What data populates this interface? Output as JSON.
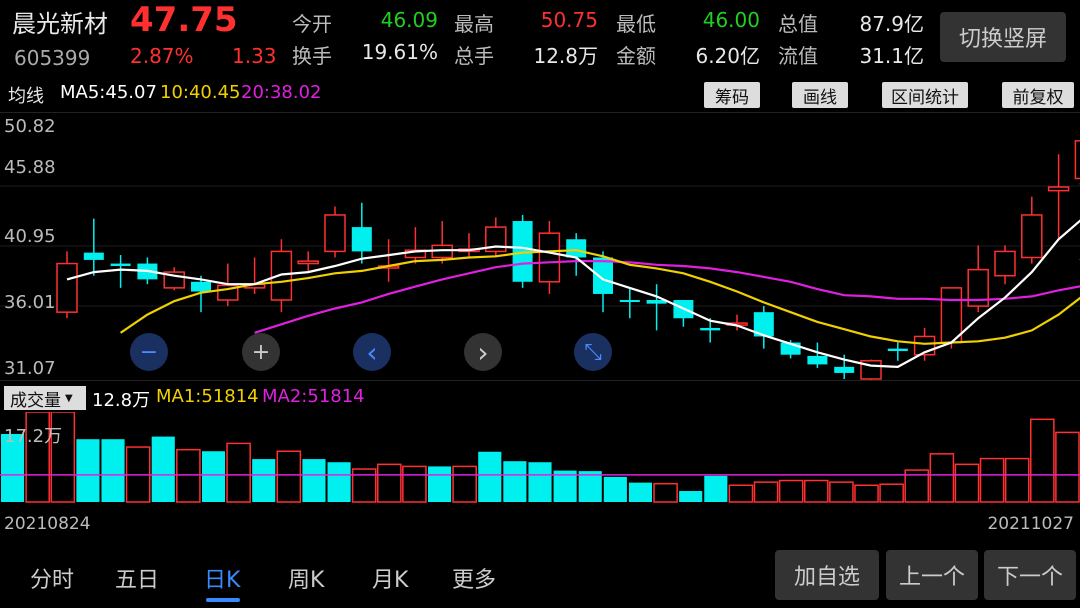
{
  "stock": {
    "name": "晨光新材",
    "code": "605399",
    "price": "47.75",
    "change_pct": "2.87%",
    "change": "1.33"
  },
  "quote": {
    "row1": [
      {
        "label": "今开",
        "value": "46.09",
        "color": "#20d020"
      },
      {
        "label": "最高",
        "value": "50.75",
        "color": "#ff3030"
      },
      {
        "label": "最低",
        "value": "46.00",
        "color": "#20d020"
      },
      {
        "label": "总值",
        "value": "87.9亿",
        "color": "#e8e8e8"
      }
    ],
    "row2": [
      {
        "label": "换手",
        "value": "19.61%",
        "color": "#e8e8e8"
      },
      {
        "label": "总手",
        "value": "12.8万",
        "color": "#e8e8e8"
      },
      {
        "label": "金额",
        "value": "6.20亿",
        "color": "#e8e8e8"
      },
      {
        "label": "流值",
        "value": "31.1亿",
        "color": "#e8e8e8"
      }
    ]
  },
  "switch_label": "切换竖屏",
  "ma_bar": {
    "label": "均线",
    "ma5": "MA5:45.07",
    "ma10": "10:40.45",
    "ma20": "20:38.02"
  },
  "tool_buttons": [
    "筹码",
    "画线",
    "区间统计",
    "前复权"
  ],
  "volume": {
    "selector": "成交量",
    "total": "12.8万",
    "ma1": "MA1:51814",
    "ma2": "MA2:51814",
    "max_label": "17.2万"
  },
  "dates": {
    "start": "20210824",
    "end": "20211027"
  },
  "bottom_tabs": [
    "分时",
    "五日",
    "日K",
    "周K",
    "月K",
    "更多"
  ],
  "active_tab": 2,
  "bottom_buttons": [
    "加自选",
    "上一个",
    "下一个"
  ],
  "controls": {
    "zoom_out": "−",
    "zoom_in": "+",
    "prev": "‹",
    "next": "›",
    "collapse": "⤡"
  },
  "chart_data": {
    "type": "candlestick",
    "price_axis": {
      "ticks": [
        "50.82",
        "45.88",
        "40.95",
        "36.01",
        "31.07"
      ],
      "min": 31.07,
      "max": 50.82
    },
    "candles": [
      {
        "o": 35.5,
        "c": 39.5,
        "h": 40.5,
        "l": 35.0
      },
      {
        "o": 40.4,
        "c": 39.8,
        "h": 43.2,
        "l": 38.5
      },
      {
        "o": 39.5,
        "c": 39.3,
        "h": 40.2,
        "l": 37.5
      },
      {
        "o": 39.5,
        "c": 38.2,
        "h": 40.0,
        "l": 37.8
      },
      {
        "o": 37.5,
        "c": 38.8,
        "h": 39.2,
        "l": 37.3
      },
      {
        "o": 38.0,
        "c": 37.2,
        "h": 38.5,
        "l": 35.5
      },
      {
        "o": 36.5,
        "c": 37.7,
        "h": 39.5,
        "l": 36.0
      },
      {
        "o": 37.5,
        "c": 37.8,
        "h": 40.0,
        "l": 37.0
      },
      {
        "o": 36.5,
        "c": 40.5,
        "h": 41.5,
        "l": 35.5
      },
      {
        "o": 39.5,
        "c": 39.7,
        "h": 40.5,
        "l": 38.8
      },
      {
        "o": 40.5,
        "c": 43.5,
        "h": 44.2,
        "l": 40.0
      },
      {
        "o": 42.5,
        "c": 40.5,
        "h": 44.5,
        "l": 39.5
      },
      {
        "o": 39.2,
        "c": 39.3,
        "h": 41.5,
        "l": 38.0
      },
      {
        "o": 40.0,
        "c": 40.6,
        "h": 42.5,
        "l": 39.5
      },
      {
        "o": 40.0,
        "c": 41.0,
        "h": 43.0,
        "l": 39.5
      },
      {
        "o": 40.5,
        "c": 40.7,
        "h": 42.0,
        "l": 40.0
      },
      {
        "o": 40.5,
        "c": 42.5,
        "h": 43.3,
        "l": 40.0
      },
      {
        "o": 43.0,
        "c": 38.0,
        "h": 43.5,
        "l": 37.5
      },
      {
        "o": 38.0,
        "c": 42.0,
        "h": 43.0,
        "l": 37.0
      },
      {
        "o": 41.5,
        "c": 40.0,
        "h": 42.0,
        "l": 38.5
      },
      {
        "o": 40.0,
        "c": 37.0,
        "h": 40.5,
        "l": 35.5
      },
      {
        "o": 36.5,
        "c": 36.4,
        "h": 37.5,
        "l": 35.0
      },
      {
        "o": 36.5,
        "c": 36.2,
        "h": 37.8,
        "l": 34.0
      },
      {
        "o": 36.5,
        "c": 35.0,
        "h": 36.5,
        "l": 34.3
      },
      {
        "o": 34.2,
        "c": 34.0,
        "h": 35.0,
        "l": 33.0
      },
      {
        "o": 34.5,
        "c": 34.6,
        "h": 35.3,
        "l": 34.0
      },
      {
        "o": 35.5,
        "c": 33.5,
        "h": 36.0,
        "l": 32.5
      },
      {
        "o": 33.0,
        "c": 32.0,
        "h": 33.2,
        "l": 31.7
      },
      {
        "o": 31.9,
        "c": 31.2,
        "h": 33.0,
        "l": 30.9
      },
      {
        "o": 31.0,
        "c": 30.5,
        "h": 32.0,
        "l": 30.0
      },
      {
        "o": 30.0,
        "c": 31.5,
        "h": 31.6,
        "l": 29.5
      },
      {
        "o": 32.5,
        "c": 32.3,
        "h": 33.0,
        "l": 31.5
      },
      {
        "o": 32.0,
        "c": 33.5,
        "h": 34.2,
        "l": 31.5
      },
      {
        "o": 33.0,
        "c": 37.5,
        "h": 37.5,
        "l": 32.5
      },
      {
        "o": 36.0,
        "c": 39.0,
        "h": 41.0,
        "l": 35.5
      },
      {
        "o": 38.5,
        "c": 40.5,
        "h": 41.0,
        "l": 37.8
      },
      {
        "o": 40.0,
        "c": 43.5,
        "h": 45.0,
        "l": 39.5
      },
      {
        "o": 45.5,
        "c": 45.8,
        "h": 48.5,
        "l": 41.5
      },
      {
        "o": 46.5,
        "c": 49.6,
        "h": 50.8,
        "l": 46.0
      },
      {
        "o": 46.09,
        "c": 47.75,
        "h": 50.75,
        "l": 46.0
      }
    ],
    "ma5": [
      38.2,
      38.8,
      39.0,
      38.9,
      38.5,
      38.2,
      37.8,
      37.8,
      38.6,
      38.8,
      39.3,
      39.9,
      40.2,
      40.5,
      40.6,
      40.6,
      40.9,
      40.8,
      40.4,
      40.0,
      38.2,
      37.5,
      36.8,
      35.8,
      34.8,
      34.4,
      33.6,
      32.9,
      32.2,
      31.6,
      31.1,
      31.0,
      32.2,
      33.0,
      35.0,
      36.7,
      38.8,
      41.5,
      43.4,
      45.1
    ],
    "ma10": [
      null,
      null,
      33.8,
      35.3,
      36.4,
      37.1,
      37.4,
      37.8,
      38.0,
      38.3,
      38.7,
      38.9,
      39.3,
      39.7,
      39.8,
      40.0,
      40.1,
      40.4,
      40.5,
      40.6,
      40.1,
      39.4,
      39.1,
      38.7,
      38.0,
      37.2,
      36.3,
      35.5,
      34.7,
      34.1,
      33.5,
      33.1,
      32.9,
      33.0,
      33.1,
      33.4,
      34.0,
      35.3,
      37.0,
      38.8
    ],
    "ma20": [
      null,
      null,
      null,
      null,
      null,
      null,
      null,
      33.8,
      34.5,
      35.2,
      35.8,
      36.3,
      37.0,
      37.6,
      38.2,
      38.7,
      39.2,
      39.5,
      39.6,
      39.7,
      39.7,
      39.6,
      39.4,
      39.3,
      39.1,
      38.8,
      38.4,
      38.0,
      37.4,
      36.9,
      36.8,
      36.6,
      36.6,
      36.5,
      36.5,
      36.6,
      36.8,
      37.3,
      37.7,
      38.0
    ],
    "volumes": [
      130000,
      172000,
      172000,
      120000,
      120000,
      105000,
      125000,
      100000,
      97000,
      112000,
      82000,
      97000,
      82000,
      76000,
      63000,
      72000,
      68000,
      68000,
      68000,
      96000,
      78000,
      76000,
      60000,
      59000,
      48000,
      37000,
      35000,
      21000,
      50000,
      32000,
      38000,
      41000,
      41000,
      38000,
      32000,
      34000,
      61000,
      92000,
      72000,
      83000,
      83000,
      158000,
      133000
    ],
    "volume_up": [
      false,
      true,
      true,
      false,
      false,
      true,
      false,
      true,
      false,
      true,
      false,
      true,
      false,
      false,
      true,
      true,
      true,
      false,
      true,
      false,
      false,
      false,
      false,
      false,
      false,
      false,
      true,
      false,
      false,
      true,
      true,
      true,
      true,
      true,
      true,
      true,
      true,
      true,
      true,
      true,
      true,
      true,
      true
    ],
    "vol_ma": 51814
  },
  "colors": {
    "up": "#ff3030",
    "down": "#00f0f0",
    "ma5": "#ffffff",
    "ma10": "#f0d000",
    "ma20": "#e020e0"
  }
}
